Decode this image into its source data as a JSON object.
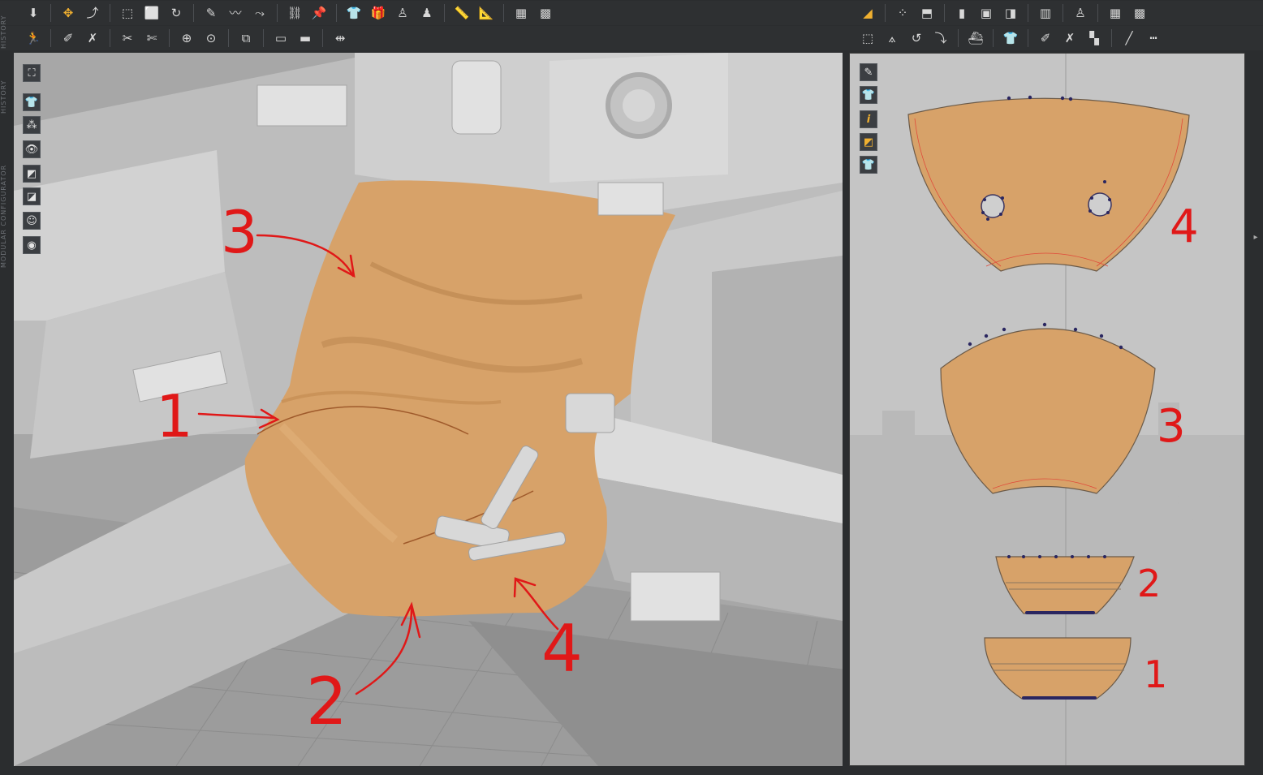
{
  "toolbar_row1_left": [
    {
      "icon": "down-arrow-icon",
      "glyph": "⬇"
    },
    {
      "icon": "select-move-icon",
      "glyph": "✥",
      "active": true
    },
    {
      "icon": "select-point-icon",
      "glyph": "⤴"
    },
    {
      "icon": "transform-pattern-icon",
      "glyph": "⬚"
    },
    {
      "icon": "transform-box-icon",
      "glyph": "⬜"
    },
    {
      "icon": "rotate-pattern-icon",
      "glyph": "↻"
    },
    {
      "icon": "pen-icon",
      "glyph": "✎"
    },
    {
      "icon": "curve-icon",
      "glyph": "〰"
    },
    {
      "icon": "fold-icon",
      "glyph": "⤳"
    },
    {
      "icon": "tape-icon",
      "glyph": "⛓"
    },
    {
      "icon": "pin-icon",
      "glyph": "📌"
    },
    {
      "icon": "shirt-icon",
      "glyph": "👕"
    },
    {
      "icon": "gift-icon",
      "glyph": "🎁"
    },
    {
      "icon": "avatar-icon",
      "glyph": "♙"
    },
    {
      "icon": "avatar-pose-icon",
      "glyph": "♟"
    },
    {
      "icon": "measure-icon",
      "glyph": "📏"
    },
    {
      "icon": "ruler-icon",
      "glyph": "📐"
    },
    {
      "icon": "grid-icon",
      "glyph": "▦"
    },
    {
      "icon": "grid-plus-icon",
      "glyph": "▩"
    }
  ],
  "toolbar_row2_left": [
    {
      "icon": "simulate-icon",
      "glyph": "🏃"
    },
    {
      "icon": "brush-icon",
      "glyph": "✐"
    },
    {
      "icon": "brush-cross-icon",
      "glyph": "✗"
    },
    {
      "icon": "seam-icon",
      "glyph": "✂"
    },
    {
      "icon": "seam-cross-icon",
      "glyph": "✄"
    },
    {
      "icon": "button-icon",
      "glyph": "⊕"
    },
    {
      "icon": "buttonhole-icon",
      "glyph": "⊙"
    },
    {
      "icon": "zipper-icon",
      "glyph": "⧉"
    },
    {
      "icon": "plane-icon",
      "glyph": "▭"
    },
    {
      "icon": "plane-alt-icon",
      "glyph": "▬"
    },
    {
      "icon": "add-arrows-icon",
      "glyph": "⇹"
    }
  ],
  "toolbar_row1_right": [
    {
      "icon": "edit-pattern-icon",
      "glyph": "◢",
      "active": true
    },
    {
      "icon": "edit-point-icon",
      "glyph": "⁘"
    },
    {
      "icon": "polygon-icon",
      "glyph": "⬒"
    },
    {
      "icon": "rectangle-icon",
      "glyph": "▮"
    },
    {
      "icon": "frame-icon",
      "glyph": "▣"
    },
    {
      "icon": "trace-icon",
      "glyph": "◨"
    },
    {
      "icon": "columns-icon",
      "glyph": "▥"
    },
    {
      "icon": "figure-icon",
      "glyph": "♙"
    },
    {
      "icon": "grid-icon",
      "glyph": "▦"
    },
    {
      "icon": "grid-plus-icon",
      "glyph": "▩"
    }
  ],
  "toolbar_row2_right": [
    {
      "icon": "transform-pattern-icon",
      "glyph": "⬚"
    },
    {
      "icon": "dart-icon",
      "glyph": "⟑"
    },
    {
      "icon": "rotate-point-icon",
      "glyph": "↺"
    },
    {
      "icon": "fold-arrangement-icon",
      "glyph": "⤵"
    },
    {
      "icon": "iron-icon",
      "glyph": "⛴"
    },
    {
      "icon": "shirt-arrow-icon",
      "glyph": "👕"
    },
    {
      "icon": "brush-icon",
      "glyph": "✐"
    },
    {
      "icon": "shirt-cross-icon",
      "glyph": "✗"
    },
    {
      "icon": "checker-icon",
      "glyph": "▚"
    },
    {
      "icon": "line-icon",
      "glyph": "╱"
    },
    {
      "icon": "dashed-line-icon",
      "glyph": "┅"
    }
  ],
  "side_labels": {
    "top": "HISTORY",
    "bottom": "MODULAR CONFIGURATOR"
  },
  "viewport3d_tools": [
    {
      "icon": "camera-icon",
      "glyph": "⛶"
    },
    {
      "icon": "shirt-icon",
      "glyph": "👕"
    },
    {
      "icon": "texture-dots-icon",
      "glyph": "⁂"
    },
    {
      "icon": "show-avatar-icon",
      "glyph": "👁"
    },
    {
      "icon": "fabric-icon",
      "glyph": "◩"
    },
    {
      "icon": "dark-fabric-icon",
      "glyph": "◪"
    },
    {
      "icon": "avatar-skin-icon",
      "glyph": "☺"
    },
    {
      "icon": "texture-eye-icon",
      "glyph": "◉"
    }
  ],
  "viewport2d_tools": [
    {
      "icon": "brush-icon",
      "glyph": "✎"
    },
    {
      "icon": "shirt-icon",
      "glyph": "👕"
    },
    {
      "icon": "info-icon",
      "glyph": "i"
    },
    {
      "icon": "fabric-icon",
      "glyph": "◩"
    },
    {
      "icon": "shirt-ghost-icon",
      "glyph": "👕"
    }
  ],
  "annotations_3d": [
    "1",
    "2",
    "3",
    "4"
  ],
  "annotations_2d": [
    "4",
    "3",
    "2",
    "1"
  ],
  "colors": {
    "fabric": "#d7a269",
    "annotation": "#e01818",
    "panel_bg": "#2e3032",
    "pin": "#2a2660"
  }
}
